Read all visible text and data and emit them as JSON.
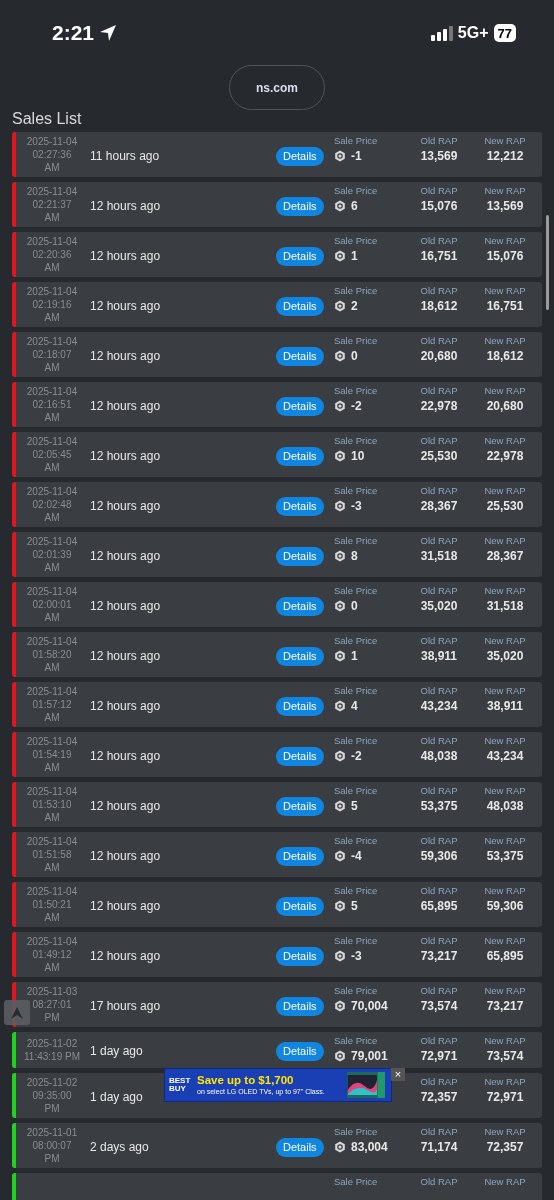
{
  "status_bar": {
    "time": "2:21",
    "network": "5G+",
    "battery": "77"
  },
  "address_bar": {
    "url": "ns.com"
  },
  "title": "Sales List",
  "rows": [
    {
      "color": "#e0161e",
      "date_lines": [
        "2025-11-04",
        "02:27:36",
        "AM"
      ],
      "ago": "11 hours ago",
      "button": "Details",
      "sale_label": "Sale Price",
      "sale": "-1",
      "old_label": "Old RAP",
      "old": "13,569",
      "new_label": "New RAP",
      "new": "12,212"
    },
    {
      "color": "#e0161e",
      "date_lines": [
        "2025-11-04",
        "02:21:37",
        "AM"
      ],
      "ago": "12 hours ago",
      "button": "Details",
      "sale_label": "Sale Price",
      "sale": "6",
      "old_label": "Old RAP",
      "old": "15,076",
      "new_label": "New RAP",
      "new": "13,569"
    },
    {
      "color": "#e0161e",
      "date_lines": [
        "2025-11-04",
        "02:20:36",
        "AM"
      ],
      "ago": "12 hours ago",
      "button": "Details",
      "sale_label": "Sale Price",
      "sale": "1",
      "old_label": "Old RAP",
      "old": "16,751",
      "new_label": "New RAP",
      "new": "15,076"
    },
    {
      "color": "#e0161e",
      "date_lines": [
        "2025-11-04",
        "02:19:16",
        "AM"
      ],
      "ago": "12 hours ago",
      "button": "Details",
      "sale_label": "Sale Price",
      "sale": "2",
      "old_label": "Old RAP",
      "old": "18,612",
      "new_label": "New RAP",
      "new": "16,751"
    },
    {
      "color": "#e0161e",
      "date_lines": [
        "2025-11-04",
        "02:18:07",
        "AM"
      ],
      "ago": "12 hours ago",
      "button": "Details",
      "sale_label": "Sale Price",
      "sale": "0",
      "old_label": "Old RAP",
      "old": "20,680",
      "new_label": "New RAP",
      "new": "18,612"
    },
    {
      "color": "#e0161e",
      "date_lines": [
        "2025-11-04",
        "02:16:51",
        "AM"
      ],
      "ago": "12 hours ago",
      "button": "Details",
      "sale_label": "Sale Price",
      "sale": "-2",
      "old_label": "Old RAP",
      "old": "22,978",
      "new_label": "New RAP",
      "new": "20,680"
    },
    {
      "color": "#e0161e",
      "date_lines": [
        "2025-11-04",
        "02:05:45",
        "AM"
      ],
      "ago": "12 hours ago",
      "button": "Details",
      "sale_label": "Sale Price",
      "sale": "10",
      "old_label": "Old RAP",
      "old": "25,530",
      "new_label": "New RAP",
      "new": "22,978"
    },
    {
      "color": "#e0161e",
      "date_lines": [
        "2025-11-04",
        "02:02:48",
        "AM"
      ],
      "ago": "12 hours ago",
      "button": "Details",
      "sale_label": "Sale Price",
      "sale": "-3",
      "old_label": "Old RAP",
      "old": "28,367",
      "new_label": "New RAP",
      "new": "25,530"
    },
    {
      "color": "#e0161e",
      "date_lines": [
        "2025-11-04",
        "02:01:39",
        "AM"
      ],
      "ago": "12 hours ago",
      "button": "Details",
      "sale_label": "Sale Price",
      "sale": "8",
      "old_label": "Old RAP",
      "old": "31,518",
      "new_label": "New RAP",
      "new": "28,367"
    },
    {
      "color": "#e0161e",
      "date_lines": [
        "2025-11-04",
        "02:00:01",
        "AM"
      ],
      "ago": "12 hours ago",
      "button": "Details",
      "sale_label": "Sale Price",
      "sale": "0",
      "old_label": "Old RAP",
      "old": "35,020",
      "new_label": "New RAP",
      "new": "31,518"
    },
    {
      "color": "#e0161e",
      "date_lines": [
        "2025-11-04",
        "01:58:20",
        "AM"
      ],
      "ago": "12 hours ago",
      "button": "Details",
      "sale_label": "Sale Price",
      "sale": "1",
      "old_label": "Old RAP",
      "old": "38,911",
      "new_label": "New RAP",
      "new": "35,020"
    },
    {
      "color": "#e0161e",
      "date_lines": [
        "2025-11-04",
        "01:57:12",
        "AM"
      ],
      "ago": "12 hours ago",
      "button": "Details",
      "sale_label": "Sale Price",
      "sale": "4",
      "old_label": "Old RAP",
      "old": "43,234",
      "new_label": "New RAP",
      "new": "38,911"
    },
    {
      "color": "#e0161e",
      "date_lines": [
        "2025-11-04",
        "01:54:19",
        "AM"
      ],
      "ago": "12 hours ago",
      "button": "Details",
      "sale_label": "Sale Price",
      "sale": "-2",
      "old_label": "Old RAP",
      "old": "48,038",
      "new_label": "New RAP",
      "new": "43,234"
    },
    {
      "color": "#e0161e",
      "date_lines": [
        "2025-11-04",
        "01:53:10",
        "AM"
      ],
      "ago": "12 hours ago",
      "button": "Details",
      "sale_label": "Sale Price",
      "sale": "5",
      "old_label": "Old RAP",
      "old": "53,375",
      "new_label": "New RAP",
      "new": "48,038"
    },
    {
      "color": "#e0161e",
      "date_lines": [
        "2025-11-04",
        "01:51:58",
        "AM"
      ],
      "ago": "12 hours ago",
      "button": "Details",
      "sale_label": "Sale Price",
      "sale": "-4",
      "old_label": "Old RAP",
      "old": "59,306",
      "new_label": "New RAP",
      "new": "53,375"
    },
    {
      "color": "#e0161e",
      "date_lines": [
        "2025-11-04",
        "01:50:21",
        "AM"
      ],
      "ago": "12 hours ago",
      "button": "Details",
      "sale_label": "Sale Price",
      "sale": "5",
      "old_label": "Old RAP",
      "old": "65,895",
      "new_label": "New RAP",
      "new": "59,306"
    },
    {
      "color": "#e0161e",
      "date_lines": [
        "2025-11-04",
        "01:49:12",
        "AM"
      ],
      "ago": "12 hours ago",
      "button": "Details",
      "sale_label": "Sale Price",
      "sale": "-3",
      "old_label": "Old RAP",
      "old": "73,217",
      "new_label": "New RAP",
      "new": "65,895"
    },
    {
      "color": "#e0161e",
      "date_lines": [
        "2025-11-03",
        "08:27:01",
        "PM"
      ],
      "ago": "17 hours ago",
      "button": "Details",
      "sale_label": "Sale Price",
      "sale": "70,004",
      "old_label": "Old RAP",
      "old": "73,574",
      "new_label": "New RAP",
      "new": "73,217"
    },
    {
      "color": "#22d11f",
      "date_lines": [
        "2025-11-02",
        "11:43:19 PM"
      ],
      "ago": "1 day ago",
      "button": "Details",
      "sale_label": "Sale Price",
      "sale": "79,001",
      "old_label": "Old RAP",
      "old": "72,971",
      "new_label": "New RAP",
      "new": "73,574"
    },
    {
      "color": "#22d11f",
      "date_lines": [
        "2025-11-02",
        "09:35:00",
        "PM"
      ],
      "ago": "1 day ago",
      "old_label": "Old RAP",
      "old": "72,357",
      "new_label": "New RAP",
      "new": "72,971"
    },
    {
      "color": "#22d11f",
      "date_lines": [
        "2025-11-01",
        "08:00:07",
        "PM"
      ],
      "ago": "2 days ago",
      "button": "Details",
      "sale_label": "Sale Price",
      "sale": "83,004",
      "old_label": "Old RAP",
      "old": "71,174",
      "new_label": "New RAP",
      "new": "72,357"
    },
    {
      "color": "#22d11f",
      "sale_label": "Sale Price",
      "old_label": "Old RAP",
      "new_label": "New RAP"
    }
  ],
  "ad": {
    "brand": "BEST BUY",
    "headline": "Save up to $1,700",
    "subtext": "on select LG OLED TVs, up to 97\" Class.",
    "close": "×"
  }
}
